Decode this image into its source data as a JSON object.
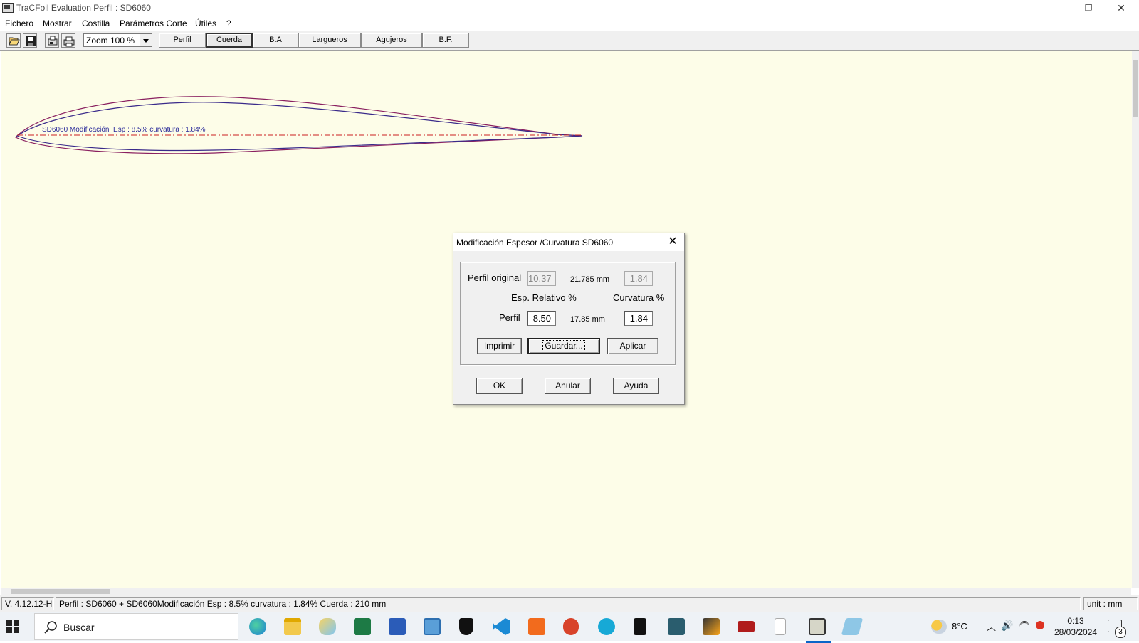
{
  "window": {
    "title": "TraCFoil Evaluation Perfil : SD6060",
    "minimize": "—",
    "restore": "❐",
    "close": "✕"
  },
  "menu": [
    "Fichero",
    "Mostrar",
    "Costilla",
    "Parámetros Corte",
    "Útiles",
    "?"
  ],
  "toolbar": {
    "icons": [
      "open-folder-icon",
      "save-icon",
      "print-setup-icon",
      "print-icon"
    ],
    "zoom": "Zoom 100 %",
    "tabs": [
      "Perfil",
      "Cuerda",
      "B.A",
      "Largueros",
      "Agujeros",
      "B.F."
    ],
    "active_tab": "Cuerda"
  },
  "canvas": {
    "background": "#fdfde8",
    "airfoil_label": "SD6060 Modificación  Esp : 8.5% curvatura : 1.84%",
    "airfoil_color": "#3a2a8a",
    "original_color": "#8a2060",
    "chord_line_color": "#cc2020"
  },
  "status": {
    "version": "V. 4.12.12-H",
    "info": "Perfil : SD6060 + SD6060Modificación  Esp : 8.5% curvatura : 1.84% Cuerda : 210 mm",
    "unit": "unit : mm"
  },
  "dialog": {
    "title": "Modificación Espesor /Curvatura SD6060",
    "close": "✕",
    "original_label": "Perfil original",
    "original_thickness": "10.37",
    "original_mm": "21.785 mm",
    "original_camber": "1.84",
    "thickness_header": "Esp. Relativo %",
    "camber_header": "Curvatura %",
    "profile_label": "Perfil",
    "profile_thickness": "8.50",
    "profile_mm": "17.85 mm",
    "profile_camber": "1.84",
    "btn_print": "Imprimir",
    "btn_save": "Guardar...",
    "btn_apply": "Aplicar",
    "btn_ok": "OK",
    "btn_cancel": "Anular",
    "btn_help": "Ayuda"
  },
  "taskbar": {
    "search_placeholder": "Buscar",
    "apps": [
      "edge-icon",
      "file-explorer-icon",
      "paint-icon",
      "excel-icon",
      "word-icon",
      "remote-desktop-icon",
      "defender-icon",
      "vscode-icon",
      "foxit-icon",
      "fusion-icon",
      "cura-icon",
      "notion-icon",
      "app-icon",
      "flash-icon",
      "nch-icon",
      "blank-doc-icon",
      "tracfoil-icon",
      "notes-icon"
    ],
    "weather": "8°C",
    "time": "0:13",
    "date": "28/03/2024",
    "notifications": "3"
  }
}
